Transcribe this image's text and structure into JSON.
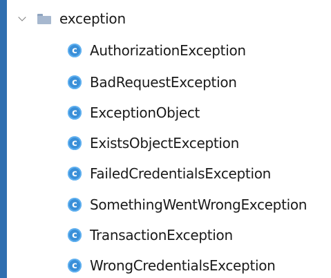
{
  "tree": {
    "folder": {
      "name": "exception",
      "icon": "folder-icon",
      "expanded": true
    },
    "items": [
      {
        "name": "AuthorizationException",
        "icon": "class-icon",
        "glyph": "c"
      },
      {
        "name": "BadRequestException",
        "icon": "class-icon",
        "glyph": "c"
      },
      {
        "name": "ExceptionObject",
        "icon": "class-icon",
        "glyph": "c"
      },
      {
        "name": "ExistsObjectException",
        "icon": "class-icon",
        "glyph": "c"
      },
      {
        "name": "FailedCredentialsException",
        "icon": "class-icon",
        "glyph": "c"
      },
      {
        "name": "SomethingWentWrongException",
        "icon": "class-icon",
        "glyph": "c"
      },
      {
        "name": "TransactionException",
        "icon": "class-icon",
        "glyph": "c"
      },
      {
        "name": "WrongCredentialsException",
        "icon": "class-icon",
        "glyph": "c"
      }
    ]
  },
  "colors": {
    "background": "#2f6fb0",
    "panel": "#ffffff",
    "class_icon": "#3a8fd8",
    "folder_icon": "#a7b8cf",
    "text": "#1a1a1a"
  }
}
